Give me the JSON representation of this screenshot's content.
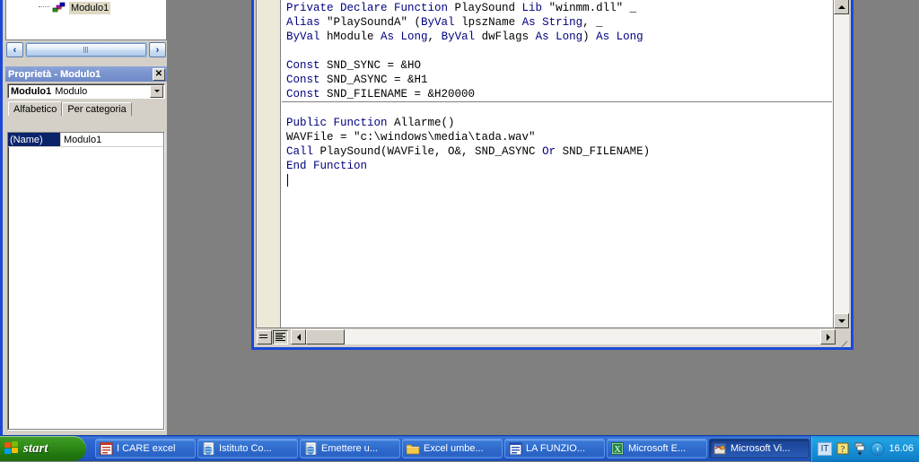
{
  "desktop": {
    "bg_color": "#808080"
  },
  "project_explorer": {
    "tree_item": {
      "label": "Modulo1",
      "icon": "module-icon"
    },
    "hscroll": {
      "left_icon": "chevron-left-icon",
      "right_icon": "chevron-right-icon"
    }
  },
  "properties_window": {
    "title": "Proprietà - Modulo1",
    "close_label": "✕",
    "object_combo": {
      "name": "Modulo1",
      "type": "Modulo"
    },
    "tabs": [
      {
        "label": "Alfabetico",
        "active": true
      },
      {
        "label": "Per categoria",
        "active": false
      }
    ],
    "rows": [
      {
        "key": "(Name)",
        "value": "Modulo1"
      }
    ]
  },
  "code_window": {
    "border_color": "#1c48d8",
    "lines": [
      {
        "indent": 0,
        "parts": [
          {
            "t": "Private Declare Function ",
            "c": "kw"
          },
          {
            "t": "PlaySound ",
            "c": "id"
          },
          {
            "t": "Lib ",
            "c": "kw"
          },
          {
            "t": "\"winmm.dll\" _",
            "c": "id"
          }
        ]
      },
      {
        "indent": 0,
        "parts": [
          {
            "t": "Alias ",
            "c": "kw"
          },
          {
            "t": "\"PlaySoundA\" (",
            "c": "id"
          },
          {
            "t": "ByVal ",
            "c": "kw"
          },
          {
            "t": "lpszName ",
            "c": "id"
          },
          {
            "t": "As String",
            "c": "kw"
          },
          {
            "t": ", _",
            "c": "id"
          }
        ]
      },
      {
        "indent": 0,
        "parts": [
          {
            "t": "ByVal ",
            "c": "kw"
          },
          {
            "t": "hModule ",
            "c": "id"
          },
          {
            "t": "As Long",
            "c": "kw"
          },
          {
            "t": ", ",
            "c": "id"
          },
          {
            "t": "ByVal ",
            "c": "kw"
          },
          {
            "t": "dwFlags ",
            "c": "id"
          },
          {
            "t": "As Long",
            "c": "kw"
          },
          {
            "t": ") ",
            "c": "id"
          },
          {
            "t": "As Long",
            "c": "kw"
          }
        ]
      },
      {
        "indent": 0,
        "parts": []
      },
      {
        "indent": 0,
        "parts": [
          {
            "t": "Const ",
            "c": "kw"
          },
          {
            "t": "SND_SYNC = &HO",
            "c": "id"
          }
        ]
      },
      {
        "indent": 0,
        "parts": [
          {
            "t": "Const ",
            "c": "kw"
          },
          {
            "t": "SND_ASYNC = &H1",
            "c": "id"
          }
        ]
      },
      {
        "indent": 0,
        "parts": [
          {
            "t": "Const ",
            "c": "kw"
          },
          {
            "t": "SND_FILENAME = &H20000",
            "c": "id"
          }
        ]
      },
      {
        "indent": 0,
        "parts": []
      },
      {
        "indent": 0,
        "parts": [
          {
            "t": "Public Function ",
            "c": "kw"
          },
          {
            "t": "Allarme()",
            "c": "id"
          }
        ]
      },
      {
        "indent": 0,
        "parts": [
          {
            "t": "WAVFile = \"c:\\windows\\media\\tada.wav\"",
            "c": "id"
          }
        ]
      },
      {
        "indent": 0,
        "parts": [
          {
            "t": "Call ",
            "c": "kw"
          },
          {
            "t": "PlaySound(WAVFile, O&, SND_ASYNC ",
            "c": "id"
          },
          {
            "t": "Or ",
            "c": "kw"
          },
          {
            "t": "SND_FILENAME)",
            "c": "id"
          }
        ]
      },
      {
        "indent": 0,
        "parts": [
          {
            "t": "End Function",
            "c": "kw"
          }
        ]
      }
    ],
    "separator_after_line": 7,
    "bottom_bar": {
      "procedure_view_icon": "procedure-view-icon",
      "full_module_view_icon": "full-module-view-icon",
      "hscroll_left_icon": "triangle-left-icon",
      "hscroll_right_icon": "triangle-right-icon"
    },
    "vscroll": {
      "up_icon": "triangle-up-icon",
      "down_icon": "triangle-down-icon"
    }
  },
  "taskbar": {
    "start_label": "start",
    "buttons": [
      {
        "label": "I CARE excel",
        "icon": "excel-doc-icon",
        "active": false
      },
      {
        "label": "Istituto Co...",
        "icon": "ie-page-icon",
        "active": false
      },
      {
        "label": "Emettere u...",
        "icon": "ie-page-icon",
        "active": false
      },
      {
        "label": "Excel umbe...",
        "icon": "folder-icon",
        "active": false
      },
      {
        "label": "LA FUNZIO...",
        "icon": "word-doc-icon",
        "active": false
      },
      {
        "label": "Microsoft E...",
        "icon": "excel-green-icon",
        "active": false
      },
      {
        "label": "Microsoft Vi...",
        "icon": "vbe-icon",
        "active": true
      }
    ],
    "tray": {
      "language": "IT",
      "help_icon": "help-question-icon",
      "network_icon": "network-icon",
      "chevron_icon": "chevron-left-circle-icon",
      "clock": "16.06"
    }
  }
}
